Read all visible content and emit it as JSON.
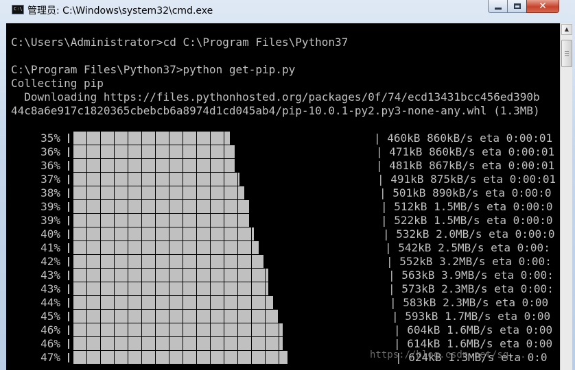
{
  "window": {
    "title": "管理员: C:\\Windows\\system32\\cmd.exe",
    "icon": "cmd-icon"
  },
  "controls": {
    "minimize": "minimize-icon",
    "maximize": "maximize-icon",
    "close": "close-icon",
    "close_glyph": "✕"
  },
  "console": {
    "lines": [
      "C:\\Users\\Administrator>cd C:\\Program Files\\Python37",
      "C:\\Program Files\\Python37>python get-pip.py",
      "Collecting pip",
      "  Downloading https://files.pythonhosted.org/packages/0f/74/ecd13431bcc456ed390b",
      "44c8a6e917c1820365cbebcb6a8974d1cd045ab4/pip-10.0.1-py2.py3-none-any.whl (1.3MB)"
    ],
    "progress": [
      {
        "percent": "35%",
        "fill": 35,
        "stats": "| 460kB 860kB/s eta 0:00:01"
      },
      {
        "percent": "36%",
        "fill": 36,
        "stats": "| 471kB 860kB/s eta 0:00:01"
      },
      {
        "percent": "36%",
        "fill": 36,
        "stats": "| 481kB 867kB/s eta 0:00:01"
      },
      {
        "percent": "37%",
        "fill": 37,
        "stats": "| 491kB 875kB/s eta 0:00:01"
      },
      {
        "percent": "38%",
        "fill": 38,
        "stats": "| 501kB 890kB/s eta 0:00:0"
      },
      {
        "percent": "39%",
        "fill": 39,
        "stats": "| 512kB 1.5MB/s eta 0:00:0"
      },
      {
        "percent": "39%",
        "fill": 39,
        "stats": "| 522kB 1.5MB/s eta 0:00:0"
      },
      {
        "percent": "40%",
        "fill": 40,
        "stats": "| 532kB 2.0MB/s eta 0:00:0"
      },
      {
        "percent": "41%",
        "fill": 41,
        "stats": "| 542kB 2.5MB/s eta 0:00:"
      },
      {
        "percent": "42%",
        "fill": 42,
        "stats": "| 552kB 3.2MB/s eta 0:00:"
      },
      {
        "percent": "43%",
        "fill": 43,
        "stats": "| 563kB 3.9MB/s eta 0:00:"
      },
      {
        "percent": "43%",
        "fill": 43,
        "stats": "| 573kB 2.3MB/s eta 0:00:"
      },
      {
        "percent": "44%",
        "fill": 44,
        "stats": "| 583kB 2.3MB/s eta 0:00"
      },
      {
        "percent": "45%",
        "fill": 45,
        "stats": "| 593kB 1.7MB/s eta 0:00"
      },
      {
        "percent": "46%",
        "fill": 46,
        "stats": "| 604kB 1.6MB/s eta 0:00"
      },
      {
        "percent": "46%",
        "fill": 46,
        "stats": "| 614kB 1.6MB/s eta 0:00"
      },
      {
        "percent": "47%",
        "fill": 47,
        "stats": "| 624kB 1.3MB/s eta 0:0"
      }
    ]
  },
  "watermark": "https://blog.csdn.net/sq...",
  "colors": {
    "console_bg": "#000000",
    "console_fg": "#c0c0c0",
    "close_button": "#c7432c"
  }
}
